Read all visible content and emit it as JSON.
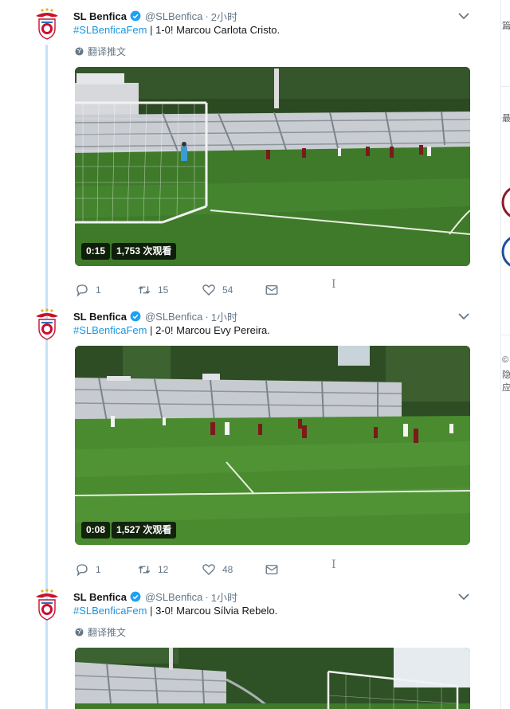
{
  "tweets": [
    {
      "name": "SL Benfica",
      "handle": "@SLBenfica",
      "time": "2小时",
      "hashtag": "#SLBenficaFem",
      "text": " | 1-0! Marcou Carlota Cristo.",
      "translate": "翻译推文",
      "video": {
        "duration": "0:15",
        "views": "1,753 次观看"
      },
      "actions": {
        "replies": "1",
        "retweets": "15",
        "likes": "54"
      }
    },
    {
      "name": "SL Benfica",
      "handle": "@SLBenfica",
      "time": "1小时",
      "hashtag": "#SLBenficaFem",
      "text": " | 2-0! Marcou Evy Pereira.",
      "video": {
        "duration": "0:08",
        "views": "1,527 次观看"
      },
      "actions": {
        "replies": "1",
        "retweets": "12",
        "likes": "48"
      }
    },
    {
      "name": "SL Benfica",
      "handle": "@SLBenfica",
      "time": "1小时",
      "hashtag": "#SLBenficaFem",
      "text": " | 3-0! Marcou Sílvia Rebelo.",
      "translate": "翻译推文"
    }
  ],
  "right_edge": {
    "glyphs": [
      "篇",
      "最",
      "©",
      "隐",
      "应"
    ]
  },
  "icons": {
    "verified": "verified-badge-icon",
    "caret": "chevron-down-icon",
    "globe": "globe-icon",
    "reply": "reply-icon",
    "retweet": "retweet-icon",
    "like": "heart-icon",
    "dm": "envelope-icon"
  },
  "colors": {
    "link": "#1b95e0",
    "secondary": "#657786",
    "thread": "#c4e4f7",
    "benfica_red": "#e30613"
  }
}
